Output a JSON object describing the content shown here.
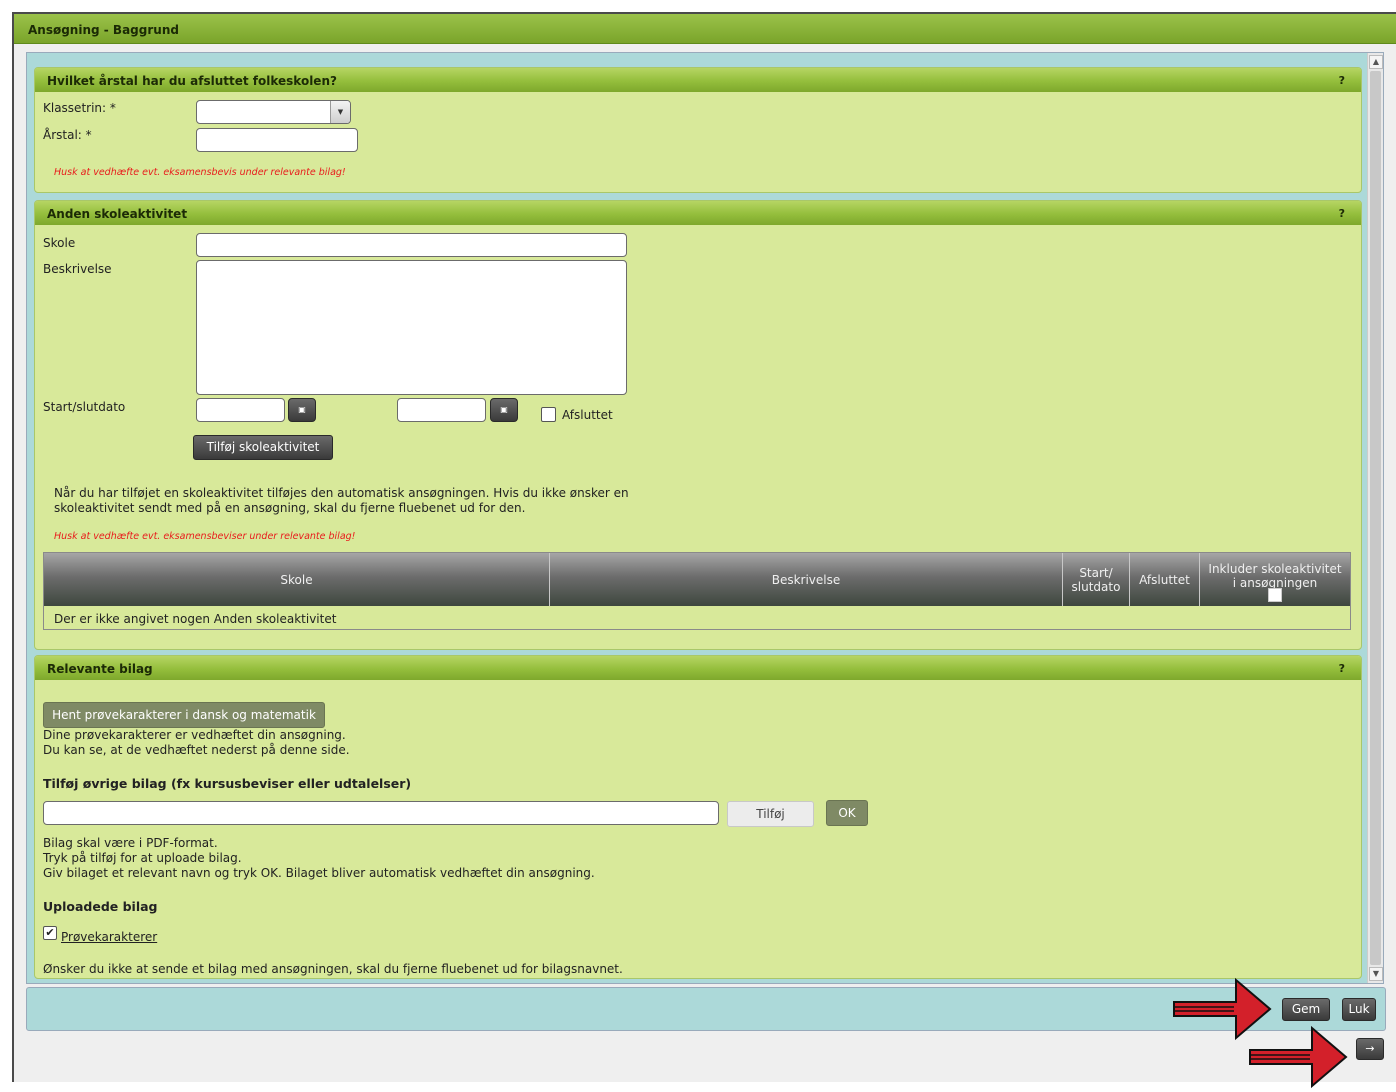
{
  "window": {
    "title": "Ansøgning - Baggrund"
  },
  "section1": {
    "title": "Hvilket årstal har du afsluttet folkeskolen?",
    "help": "?",
    "klassetrin_label": "Klassetrin: *",
    "klassetrin_value": "",
    "aarstal_label": "Årstal: *",
    "aarstal_value": "",
    "warning": "Husk at vedhæfte evt. eksamensbevis under relevante bilag!"
  },
  "section2": {
    "title": "Anden skoleaktivitet",
    "help": "?",
    "skole_label": "Skole",
    "skole_value": "",
    "beskrivelse_label": "Beskrivelse",
    "beskrivelse_value": "",
    "dato_label": "Start/slutdato",
    "startdato_value": "",
    "slutdato_value": "",
    "afsluttet_label": "Afsluttet",
    "afsluttet_checked": false,
    "add_button": "Tilføj skoleaktivitet",
    "info_line1": "Når du har tilføjet en skoleaktivitet tilføjes den automatisk ansøgningen. Hvis du ikke ønsker en",
    "info_line2": "skoleaktivitet sendt med på en ansøgning, skal du fjerne fluebenet ud for den.",
    "warning": "Husk at vedhæfte evt. eksamensbeviser under relevante bilag!",
    "table": {
      "columns": [
        "Skole",
        "Beskrivelse",
        "Start/ slutdato",
        "Afsluttet",
        "Inkluder skoleaktivitet i ansøgningen"
      ],
      "empty_text": "Der er ikke angivet nogen Anden skoleaktivitet"
    }
  },
  "section3": {
    "title": "Relevante bilag",
    "help": "?",
    "fetch_button": "Hent prøvekarakterer i dansk og matematik",
    "fetch_info1": "Dine prøvekarakterer er vedhæftet din ansøgning.",
    "fetch_info2": "Du kan se, at de vedhæftet nederst på denne side.",
    "add_heading": "Tilføj øvrige bilag (fx kursusbeviser eller udtalelser)",
    "file_value": "",
    "tilfoej_button": "Tilføj",
    "ok_button": "OK",
    "info1": "Bilag skal være i PDF-format.",
    "info2": "Tryk på tilføj for at uploade bilag.",
    "info3": "Giv bilaget et relevant navn og tryk OK. Bilaget bliver automatisk vedhæftet din ansøgning.",
    "uploaded_heading": "Uploadede bilag",
    "uploaded": [
      {
        "name": "Prøvekarakterer",
        "checked": true
      }
    ],
    "footer_note": "Ønsker du ikke at sende et bilag med ansøgningen, skal du fjerne fluebenet ud for bilagsnavnet."
  },
  "footer": {
    "gem_button": "Gem",
    "luk_button": "Luk",
    "next_button": "→"
  },
  "colors": {
    "panel_bg": "#d8e99a",
    "header_green": "#94be3c",
    "warning_red": "#e81c1c",
    "arrow_red": "#d3202a",
    "content_bg": "#acd9d9"
  }
}
